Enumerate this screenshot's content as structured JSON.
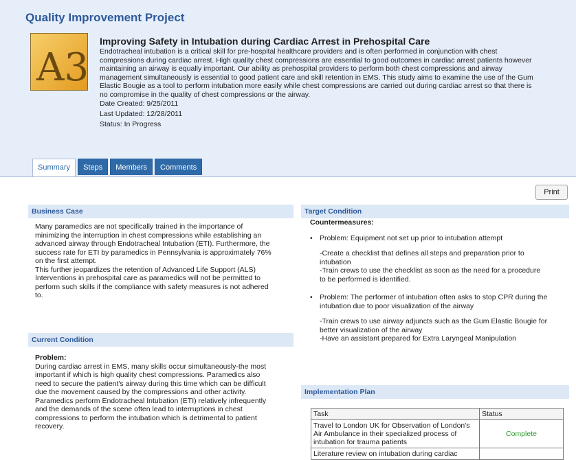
{
  "page": {
    "title": "Quality Improvement Project"
  },
  "logo": {
    "text": "A3",
    "colors": {
      "background": "#f2b33d",
      "text": "#6b4a12"
    }
  },
  "project": {
    "title": "Improving Safety in Intubation during Cardiac Arrest in Prehospital Care",
    "description_lines": [
      "Endotracheal intubation is a critical skill for pre-hospital healthcare providers and is often performed in conjunction with chest",
      "compressions during cardiac arrest. High quality chest compressions are essential to good outcomes in cardiac arrest patients however",
      "maintaining an airway is equally important. Our ability as prehospital providers to perform both chest compressions and airway",
      "management simultaneously is essential to good patient care and skill retention in EMS. This study aims to examine the use of the Gum",
      "Elastic Bougie as a tool to perform intubation more easily while chest compressions are carried out during cardiac arrest so that there is",
      "no compromise in the quality of chest compressions or the airway."
    ],
    "date_created": "Date Created: 9/25/2011",
    "last_updated": "Last Updated: 12/28/2011",
    "status": "Status: In Progress"
  },
  "tabs": [
    {
      "label": "Summary",
      "active": true
    },
    {
      "label": "Steps",
      "active": false
    },
    {
      "label": "Members",
      "active": false
    },
    {
      "label": "Comments",
      "active": false
    }
  ],
  "toolbar": {
    "print_label": "Print"
  },
  "business_case": {
    "heading": "Business Case",
    "lines": [
      "Many paramedics are not specifically trained in the importance of",
      "minimizing the interruption in chest compressions while establishing an",
      "advanced airway through Endotracheal Intubation (ETI). Furthermore, the",
      "success rate for ETI by paramedics in Pennsylvania is approximately 76%",
      "on the first attempt.",
      "This further jeopardizes the retention of Advanced Life Support (ALS)",
      "Interventions in prehospital care as paramedics will not be permitted to",
      "perform such skills if the compliance with safety measures is not adhered",
      "to."
    ]
  },
  "current_condition": {
    "heading": "Current Condition",
    "problem_label": "Problem:",
    "lines": [
      "During cardiac arrest in EMS, many skills occur simultaneously-the most",
      "important if which is high quality chest compressions. Paramedics also",
      "need to secure the patient's airway during this time which can be difficult",
      "due the movement caused by the compressions and other activity.",
      "Paramedics perform Endotracheal Intubation (ETI) relatively infrequently",
      "and the demands of the scene often lead to interruptions in chest",
      "compressions to perform the intubation which is detrimental to patient",
      "recovery."
    ]
  },
  "target_condition": {
    "heading": "Target Condition",
    "countermeasures_label": "Countermeasures:",
    "items": [
      {
        "problem": "Problem: Equipment not set up prior to intubation attempt",
        "actions": [
          "-Create a checklist that defines all steps and preparation prior to",
          "intubation",
          "-Train crews to use the checklist as soon as the need for a procedure",
          "to be performed is identified."
        ]
      },
      {
        "problem_lines": [
          "Problem: The performer of intubation often asks to stop CPR during the",
          "intubation due to poor visualization of the airway"
        ],
        "actions": [
          "-Train crews to use airway adjuncts such as the Gum Elastic Bougie for",
          "better visualization of the airway",
          "-Have an assistant prepared for Extra Laryngeal Manipulation"
        ]
      }
    ]
  },
  "implementation_plan": {
    "heading": "Implementation Plan",
    "columns": [
      "Task",
      "Status"
    ],
    "rows": [
      {
        "task_lines": [
          "Travel to London UK for Observation of London's",
          "Air Ambulance in their specialized process of",
          "intubation for trauma patients"
        ],
        "status": "Complete"
      },
      {
        "task_lines": [
          "Literature review on intubation during cardiac"
        ],
        "status": ""
      }
    ]
  }
}
